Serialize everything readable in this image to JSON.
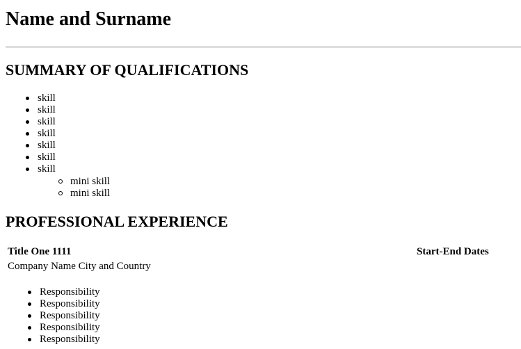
{
  "header": {
    "name": "Name and Surname"
  },
  "summary": {
    "heading": "SUMMARY OF QUALIFICATIONS",
    "skills": [
      "skill",
      "skill",
      "skill",
      "skill",
      "skill",
      "skill",
      "skill"
    ],
    "mini_skills": [
      "mini skill",
      "mini skill"
    ]
  },
  "experience": {
    "heading": "PROFESSIONAL EXPERIENCE",
    "jobs": [
      {
        "title": "Title One 1111",
        "dates": "Start-End Dates",
        "company": "Company Name City and Country",
        "responsibilities": [
          "Responsibility",
          "Responsibility",
          "Responsibility",
          "Responsibility",
          "Responsibility"
        ]
      }
    ]
  }
}
